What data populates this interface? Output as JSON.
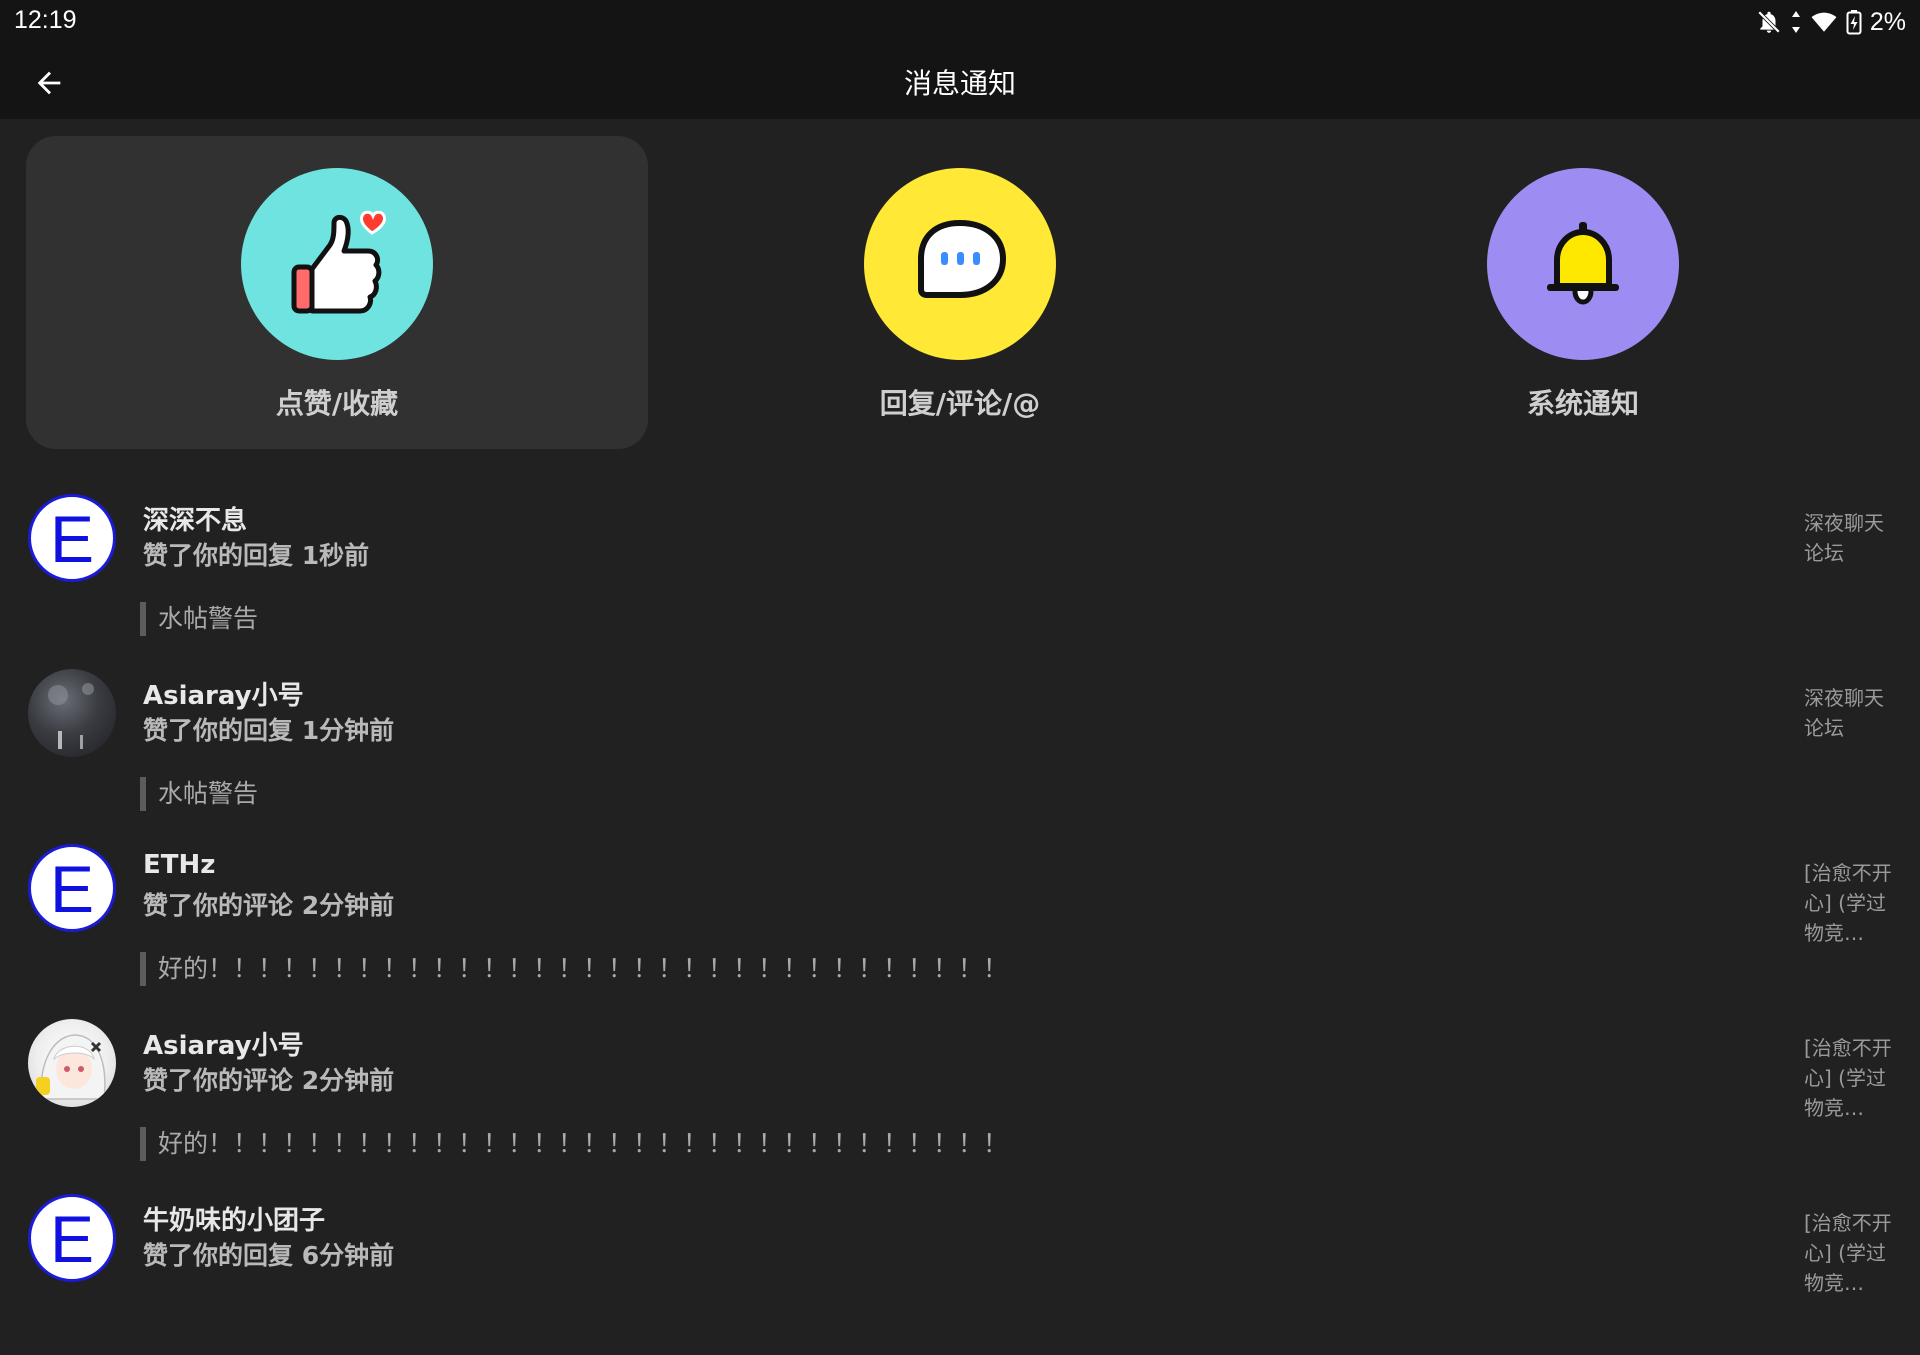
{
  "status": {
    "time": "12:19",
    "battery": "2%",
    "icons": [
      "notifications-off-icon",
      "data-arrows-icon",
      "wifi-icon",
      "battery-charging-icon"
    ]
  },
  "header": {
    "title": "消息通知",
    "back_icon": "arrow-left-icon"
  },
  "categories": [
    {
      "label": "点赞/收藏",
      "icon": "thumbs-up-heart-icon",
      "color": "#6ee3e0",
      "active": true
    },
    {
      "label": "回复/评论/@",
      "icon": "chat-bubble-icon",
      "color": "#ffe836",
      "active": false
    },
    {
      "label": "系统通知",
      "icon": "bell-icon",
      "color": "#9d8df2",
      "active": false
    }
  ],
  "notifications": [
    {
      "user": "深深不息",
      "action": "赞了你的回复 1秒前",
      "quote": "水帖警告",
      "source": "深夜聊天论坛",
      "avatar": "E"
    },
    {
      "user": "Asiaray小号",
      "action": "赞了你的回复 1分钟前",
      "quote": "水帖警告",
      "source": "深夜聊天论坛",
      "avatar": "photo"
    },
    {
      "user": "ETHz",
      "action": "赞了你的评论 2分钟前",
      "quote": "好的！！！！！！！！！！！！！！！！！！！！！！！！！！！！！！！！",
      "source": "[治愈不开心] (学过物竞…",
      "avatar": "E"
    },
    {
      "user": "Asiaray小号",
      "action": "赞了你的评论 2分钟前",
      "quote": "好的！！！！！！！！！！！！！！！！！！！！！！！！！！！！！！！！",
      "source": "[治愈不开心] (学过物竞…",
      "avatar": "anime"
    },
    {
      "user": "牛奶味的小团子",
      "action": "赞了你的回复 6分钟前",
      "quote": "",
      "source": "[治愈不开心] (学过物竞…",
      "avatar": "E"
    }
  ],
  "colors": {
    "background": "#212121",
    "header": "#141414",
    "active_category": "#313131",
    "avatar_e_letter": "#1010e0"
  }
}
